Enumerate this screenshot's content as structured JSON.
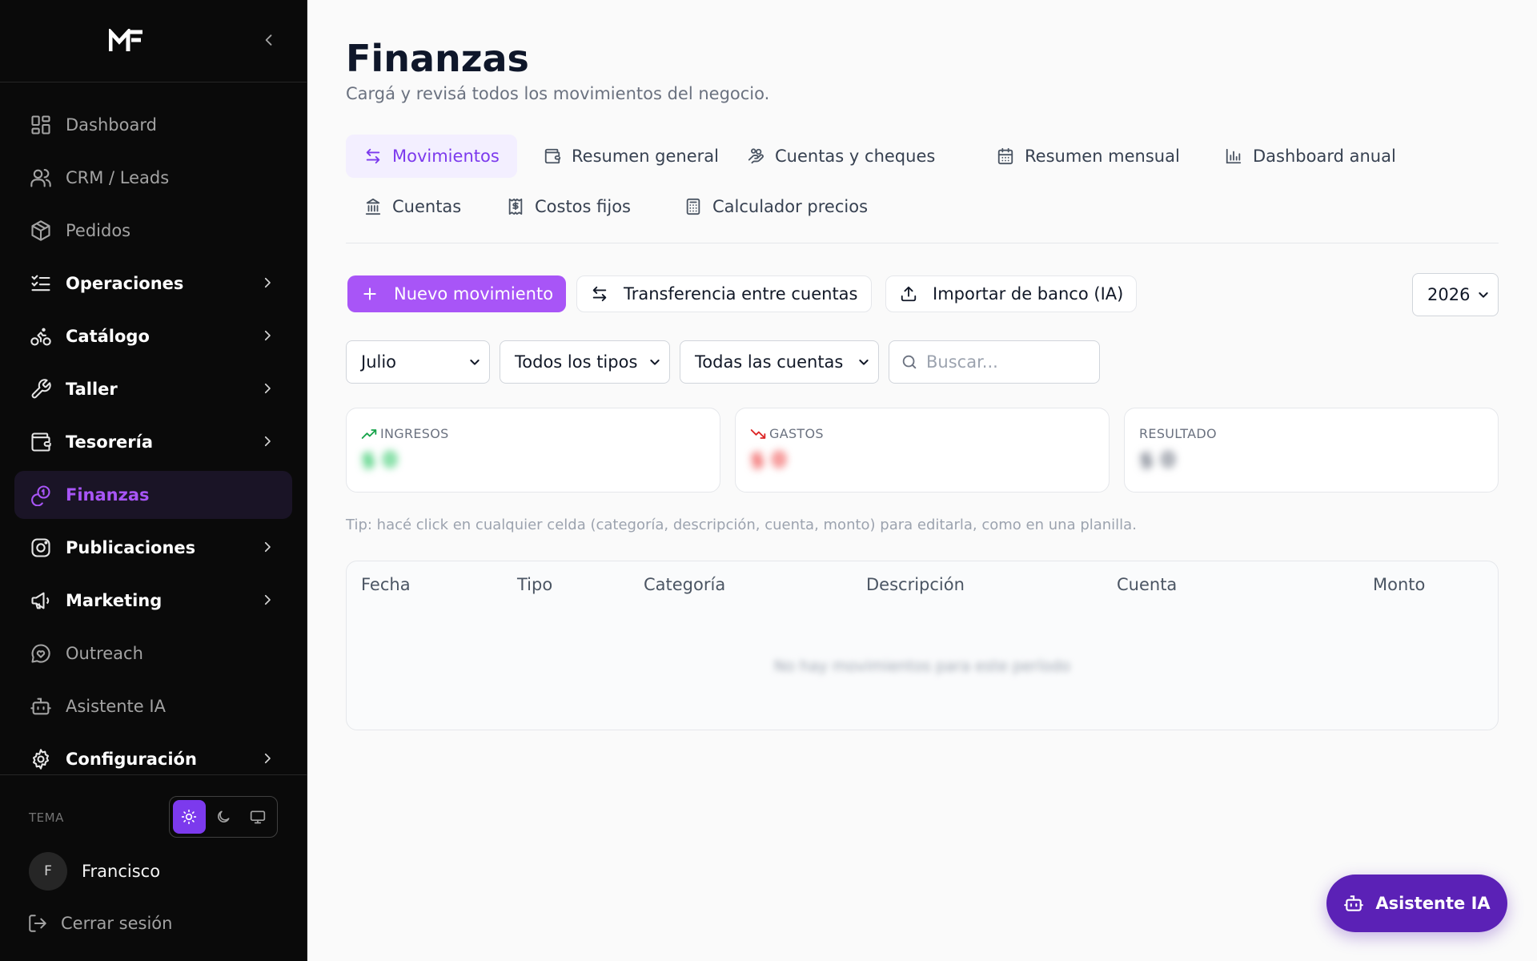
{
  "brand": {
    "logo_text": "MF"
  },
  "sidebar": {
    "items": [
      {
        "label": "Dashboard",
        "icon": "dashboard-icon",
        "group": false,
        "active": false
      },
      {
        "label": "CRM / Leads",
        "icon": "users-icon",
        "group": false,
        "active": false
      },
      {
        "label": "Pedidos",
        "icon": "package-icon",
        "group": false,
        "active": false
      },
      {
        "label": "Operaciones",
        "icon": "list-checks-icon",
        "group": true,
        "active": false
      },
      {
        "label": "Catálogo",
        "icon": "bike-icon",
        "group": true,
        "active": false
      },
      {
        "label": "Taller",
        "icon": "wrench-icon",
        "group": true,
        "active": false
      },
      {
        "label": "Tesorería",
        "icon": "wallet-icon",
        "group": true,
        "active": false
      },
      {
        "label": "Finanzas",
        "icon": "coins-icon",
        "group": false,
        "active": true
      },
      {
        "label": "Publicaciones",
        "icon": "instagram-icon",
        "group": true,
        "active": false
      },
      {
        "label": "Marketing",
        "icon": "megaphone-icon",
        "group": true,
        "active": false
      },
      {
        "label": "Outreach",
        "icon": "message-heart-icon",
        "group": false,
        "active": false
      },
      {
        "label": "Asistente IA",
        "icon": "bot-icon",
        "group": false,
        "active": false
      },
      {
        "label": "Configuración",
        "icon": "settings-icon",
        "group": true,
        "active": false
      }
    ],
    "theme_label": "TEMA",
    "theme_options": [
      "light",
      "dark",
      "system"
    ],
    "theme_selected": "light",
    "user": {
      "initial": "F",
      "name": "Francisco"
    },
    "logout_label": "Cerrar sesión"
  },
  "page": {
    "title": "Finanzas",
    "subtitle": "Cargá y revisá todos los movimientos del negocio."
  },
  "tabs": [
    {
      "label": "Movimientos",
      "icon": "arrows-left-right-icon",
      "active": true
    },
    {
      "label": "Resumen general",
      "icon": "wallet-icon",
      "active": false
    },
    {
      "label": "Cuentas y cheques",
      "icon": "hand-coins-icon",
      "active": false
    },
    {
      "label": "Resumen mensual",
      "icon": "calendar-icon",
      "active": false
    },
    {
      "label": "Dashboard anual",
      "icon": "bar-chart-icon",
      "active": false
    },
    {
      "label": "Cuentas",
      "icon": "bank-icon",
      "active": false
    },
    {
      "label": "Costos fijos",
      "icon": "receipt-icon",
      "active": false
    },
    {
      "label": "Calculador precios",
      "icon": "calculator-icon",
      "active": false
    }
  ],
  "actions": {
    "new_label": "Nuevo movimiento",
    "transfer_label": "Transferencia entre cuentas",
    "import_label": "Importar de banco (IA)",
    "year": "2026"
  },
  "filters": {
    "month": "Julio",
    "type": "Todos los tipos",
    "account": "Todas las cuentas",
    "search_placeholder": "Buscar..."
  },
  "summary": {
    "income": {
      "label": "INGRESOS",
      "value": "$ 0",
      "color": "#22c55e"
    },
    "expenses": {
      "label": "GASTOS",
      "value": "$ 0",
      "color": "#ef4444"
    },
    "result": {
      "label": "RESULTADO",
      "value": "$ 0",
      "color": "#6b7280"
    }
  },
  "tip": "Tip: hacé click en cualquier celda (categoría, descripción, cuenta, monto) para editarla, como en una planilla.",
  "table": {
    "columns": [
      "Fecha",
      "Tipo",
      "Categoría",
      "Descripción",
      "Cuenta",
      "Monto"
    ],
    "empty_text": "No hay movimientos para este período"
  },
  "fab_label": "Asistente IA",
  "colors": {
    "accent": "#a855f7",
    "accent_dark": "#5b21b6",
    "sidebar_bg": "#0a0a0a"
  }
}
